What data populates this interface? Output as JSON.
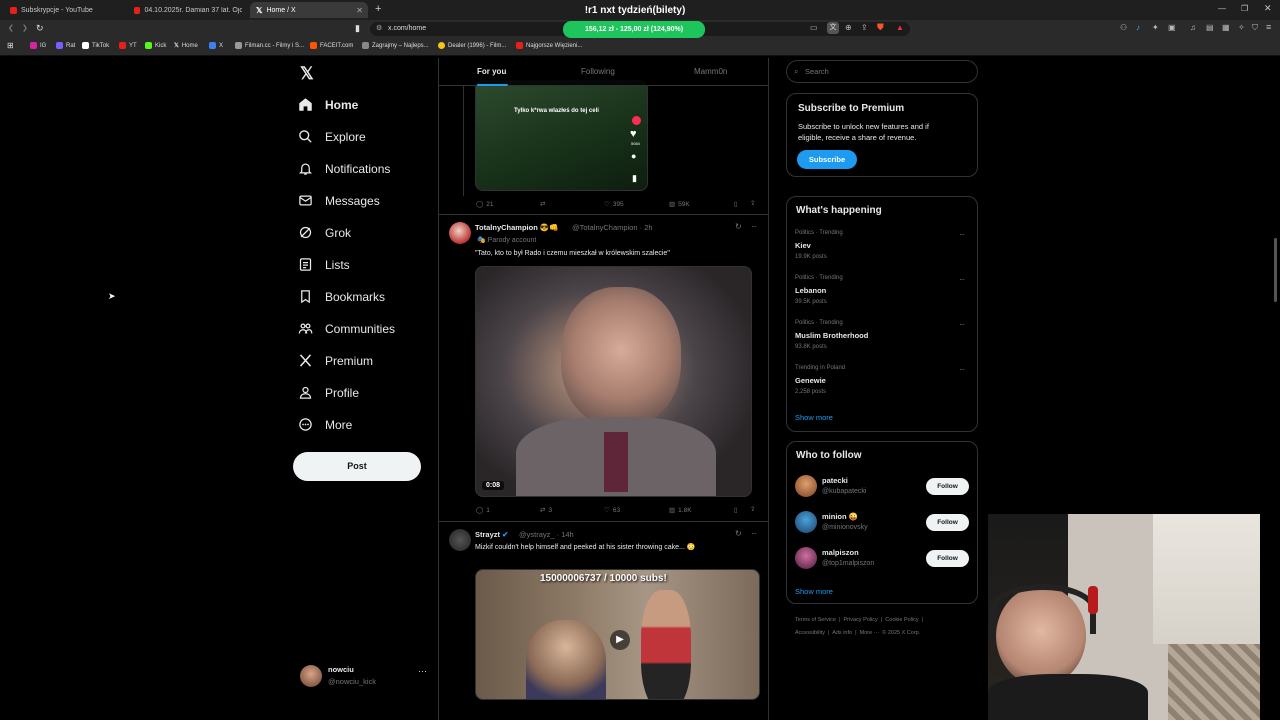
{
  "browser": {
    "tabs": [
      {
        "label": "Subskrypcje - YouTube",
        "color": "#e62117"
      },
      {
        "label": "04.10.2025r. Damian 37 lat. Ojci...",
        "color": "#e62117"
      },
      {
        "label": "Home / X",
        "color": "#ffffff"
      }
    ],
    "url": "x.com/home",
    "bookmarks": [
      {
        "label": "IG",
        "color": "#d6249f"
      },
      {
        "label": "Rat",
        "color": "#7b5cff"
      },
      {
        "label": "TikTok",
        "color": "#ffffff"
      },
      {
        "label": "YT",
        "color": "#e62117"
      },
      {
        "label": "Kick",
        "color": "#53fc18"
      },
      {
        "label": "Home",
        "color": "#ffffff"
      },
      {
        "label": "X",
        "color": "#3b82f6"
      },
      {
        "label": "Filman.cc - Filmy i S...",
        "color": "#999999"
      },
      {
        "label": "FACEIT.com",
        "color": "#ff5500"
      },
      {
        "label": "Zagrajmy – Najleps...",
        "color": "#888888"
      },
      {
        "label": "Dealer (1996) - Film...",
        "color": "#f5c518"
      },
      {
        "label": "Najgorsze Więzieni...",
        "color": "#e62117"
      }
    ]
  },
  "stream_overlay": {
    "goal_title": "!r1 nxt tydzień(bilety)",
    "goal_progress": "156,12 zł - 125,00 zł (124,90%)"
  },
  "nav": {
    "items": [
      {
        "label": "Home",
        "icon": "home-icon"
      },
      {
        "label": "Explore",
        "icon": "search-icon"
      },
      {
        "label": "Notifications",
        "icon": "bell-icon"
      },
      {
        "label": "Messages",
        "icon": "envelope-icon"
      },
      {
        "label": "Grok",
        "icon": "grok-icon"
      },
      {
        "label": "Lists",
        "icon": "list-icon"
      },
      {
        "label": "Bookmarks",
        "icon": "bookmark-icon"
      },
      {
        "label": "Communities",
        "icon": "communities-icon"
      },
      {
        "label": "Premium",
        "icon": "x-logo-icon"
      },
      {
        "label": "Profile",
        "icon": "person-icon"
      },
      {
        "label": "More",
        "icon": "more-circle-icon"
      }
    ],
    "post_label": "Post",
    "user": {
      "name": "nowciu",
      "handle": "@nowciu_kick"
    }
  },
  "feed": {
    "tabs": [
      "For you",
      "Following",
      "Mamm0n"
    ],
    "tweet0": {
      "caption": "Tylko k*rwa wlazłeś do tej celi",
      "replies": "21",
      "likes": "395",
      "views": "59K",
      "side_count": "5084"
    },
    "tweet1": {
      "name": "TotalnyChampion 😎👊",
      "handle": "@TotalnyChampion · 2h",
      "badge": "Parody account",
      "text": "\"Tato, kto to był Rado i czemu mieszkał w królewskim szalecie\"",
      "duration": "0:08",
      "replies": "1",
      "retweets": "3",
      "likes": "63",
      "views": "1.8K"
    },
    "tweet2": {
      "name": "Strayzt",
      "handle": "@ystrayz_ · 14h",
      "text": "Mizkif couldn't help himself and peeked at his sister throwing cake... 😳",
      "overlay": "15000006737 / 10000 subs!"
    }
  },
  "sidebar": {
    "search_placeholder": "Search",
    "premium": {
      "title": "Subscribe to Premium",
      "text1": "Subscribe to unlock new features and if",
      "text2": "eligible, receive a share of revenue.",
      "button": "Subscribe"
    },
    "happening": {
      "title": "What's happening",
      "trends": [
        {
          "category": "Politics · Trending",
          "name": "Kiev",
          "posts": "19.9K posts"
        },
        {
          "category": "Politics · Trending",
          "name": "Lebanon",
          "posts": "39.5K posts"
        },
        {
          "category": "Politics · Trending",
          "name": "Muslim Brotherhood",
          "posts": "93.8K posts"
        },
        {
          "category": "Trending in Poland",
          "name": "Genewie",
          "posts": "2,258 posts"
        }
      ],
      "show_more": "Show more"
    },
    "follow": {
      "title": "Who to follow",
      "users": [
        {
          "name": "patecki",
          "handle": "@kubapatecki"
        },
        {
          "name": "minion 😜",
          "handle": "@minionovsky"
        },
        {
          "name": "malpiszon",
          "handle": "@top1malpiszon"
        }
      ],
      "button": "Follow",
      "show_more": "Show more"
    },
    "footer": {
      "line1": [
        "Terms of Service",
        "Privacy Policy",
        "Cookie Policy"
      ],
      "line2": [
        "Accessibility",
        "Ads info",
        "More ···",
        "© 2025 X Corp."
      ]
    }
  },
  "colors": {
    "accent": "#1d9bf0",
    "border": "#2f3336",
    "muted": "#71767b",
    "goal_green": "#1ec45c"
  }
}
